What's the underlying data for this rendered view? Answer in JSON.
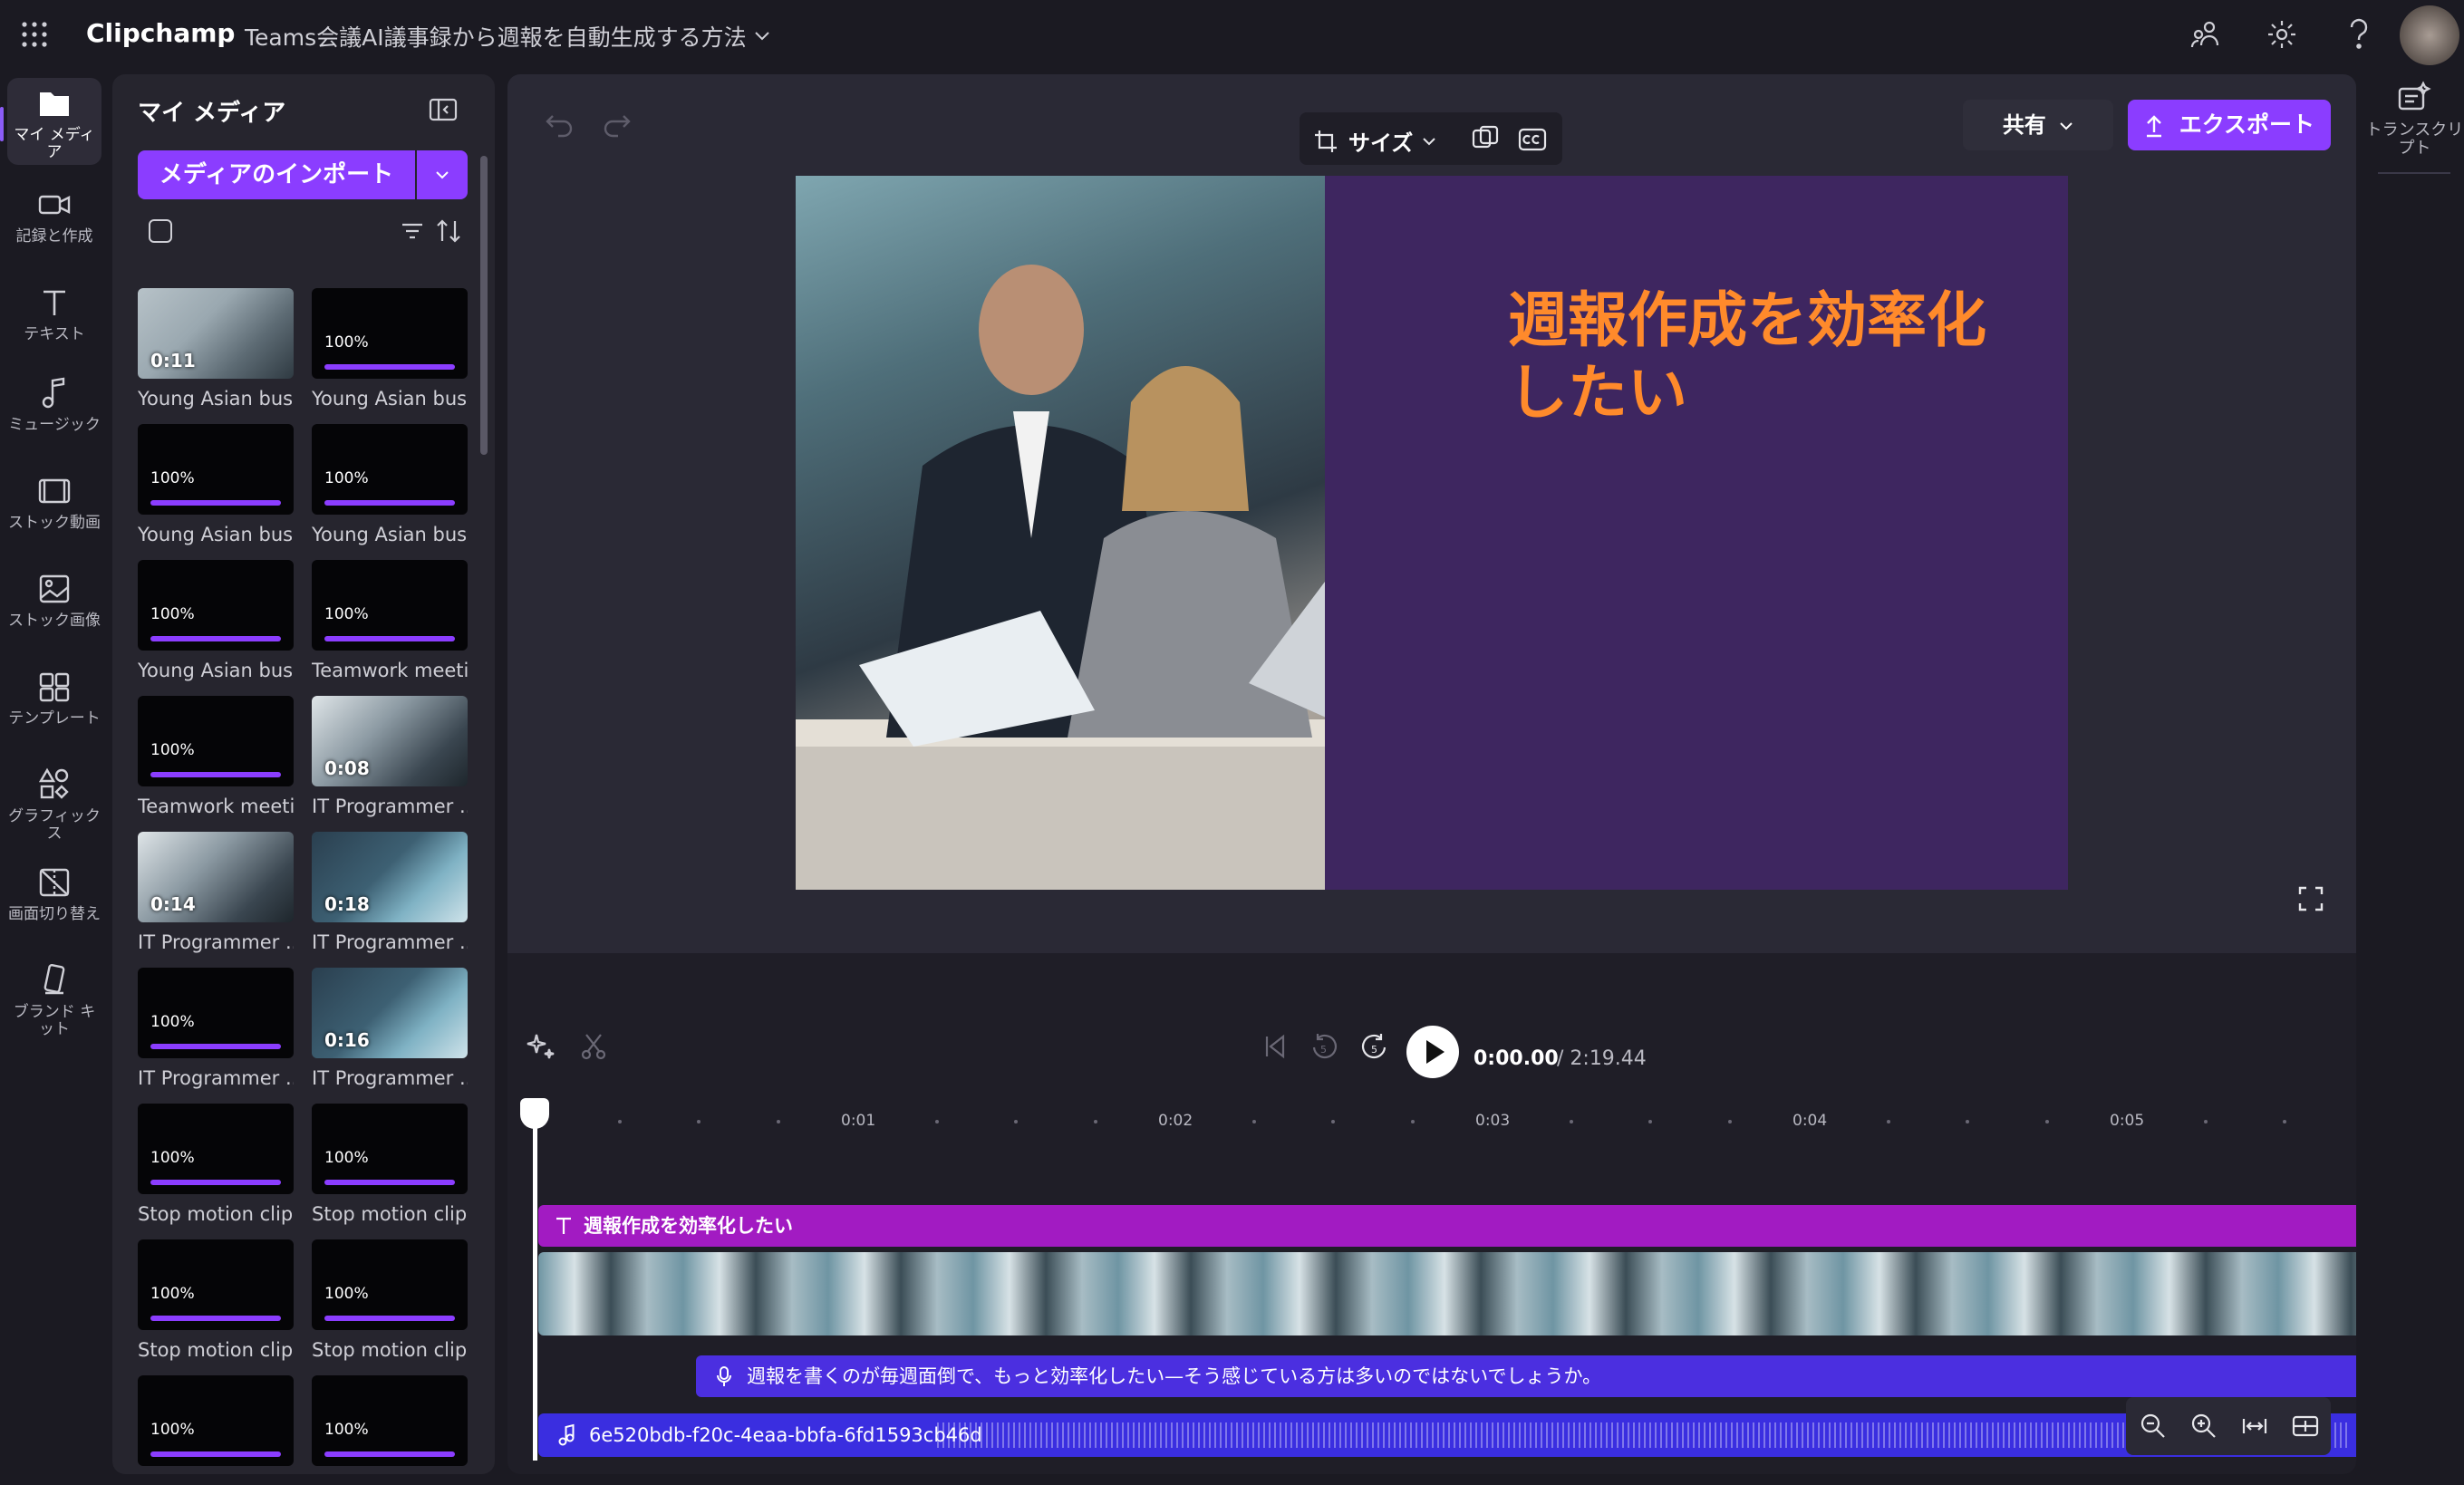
{
  "app": {
    "name": "Clipchamp",
    "project_title": "Teams会議AI議事録から週報を自動生成する方法"
  },
  "rail": [
    {
      "label": "マイ メディア",
      "icon": "folder-icon"
    },
    {
      "label": "記録と作成",
      "icon": "camera-icon"
    },
    {
      "label": "テキスト",
      "icon": "text-icon"
    },
    {
      "label": "ミュージック",
      "icon": "music-icon"
    },
    {
      "label": "ストック動画",
      "icon": "film-icon"
    },
    {
      "label": "ストック画像",
      "icon": "image-icon"
    },
    {
      "label": "テンプレート",
      "icon": "template-icon"
    },
    {
      "label": "グラフィックス",
      "icon": "shapes-icon"
    },
    {
      "label": "画面切り替え",
      "icon": "transition-icon"
    },
    {
      "label": "ブランド キット",
      "icon": "brand-icon"
    }
  ],
  "media": {
    "title": "マイ メディア",
    "import_label": "メディアのインポート",
    "items": [
      {
        "label": "Young Asian bus...",
        "duration": "0:11",
        "progress": ""
      },
      {
        "label": "Young Asian bus...",
        "duration": "",
        "progress": "100%"
      },
      {
        "label": "Young Asian bus...",
        "duration": "",
        "progress": "100%"
      },
      {
        "label": "Young Asian bus...",
        "duration": "",
        "progress": "100%"
      },
      {
        "label": "Young Asian bus...",
        "duration": "",
        "progress": "100%"
      },
      {
        "label": "Teamwork meeti...",
        "duration": "",
        "progress": "100%"
      },
      {
        "label": "Teamwork meeti...",
        "duration": "",
        "progress": "100%"
      },
      {
        "label": "IT Programmer ...",
        "duration": "0:08",
        "progress": ""
      },
      {
        "label": "IT Programmer ...",
        "duration": "0:14",
        "progress": ""
      },
      {
        "label": "IT Programmer ...",
        "duration": "0:18",
        "progress": ""
      },
      {
        "label": "IT Programmer ...",
        "duration": "",
        "progress": "100%"
      },
      {
        "label": "IT Programmer ...",
        "duration": "0:16",
        "progress": ""
      },
      {
        "label": "Stop motion clip...",
        "duration": "",
        "progress": "100%"
      },
      {
        "label": "Stop motion clip...",
        "duration": "",
        "progress": "100%"
      },
      {
        "label": "Stop motion clip...",
        "duration": "",
        "progress": "100%"
      },
      {
        "label": "Stop motion clip...",
        "duration": "",
        "progress": "100%"
      },
      {
        "label": "",
        "duration": "",
        "progress": "100%"
      },
      {
        "label": "",
        "duration": "",
        "progress": "100%"
      }
    ]
  },
  "preview": {
    "size_label": "サイズ",
    "share_label": "共有",
    "export_label": "エクスポート",
    "headline": "週報作成を効率化したい"
  },
  "timeline": {
    "current_time": "0:00.00",
    "total_time": "/ 2:19.44",
    "ticks": [
      "0:01",
      "0:02",
      "0:03",
      "0:04",
      "0:05"
    ],
    "text_track": "週報作成を効率化したい",
    "voice_track": "週報を書くのが毎週面倒で、もっと効率化したい—そう感じている方は多いのではないでしょうか。",
    "audio_track": "6e520bdb-f20c-4eaa-bbfa-6fd1593cb46d"
  },
  "right_panel": {
    "transcript_label": "トランスクリプト"
  },
  "colors": {
    "accent": "#8b3dff",
    "headline": "#ff8a2b",
    "video_bg": "#3e2660",
    "text_track": "#a21bc2",
    "voice_track": "#4b2fe0"
  }
}
